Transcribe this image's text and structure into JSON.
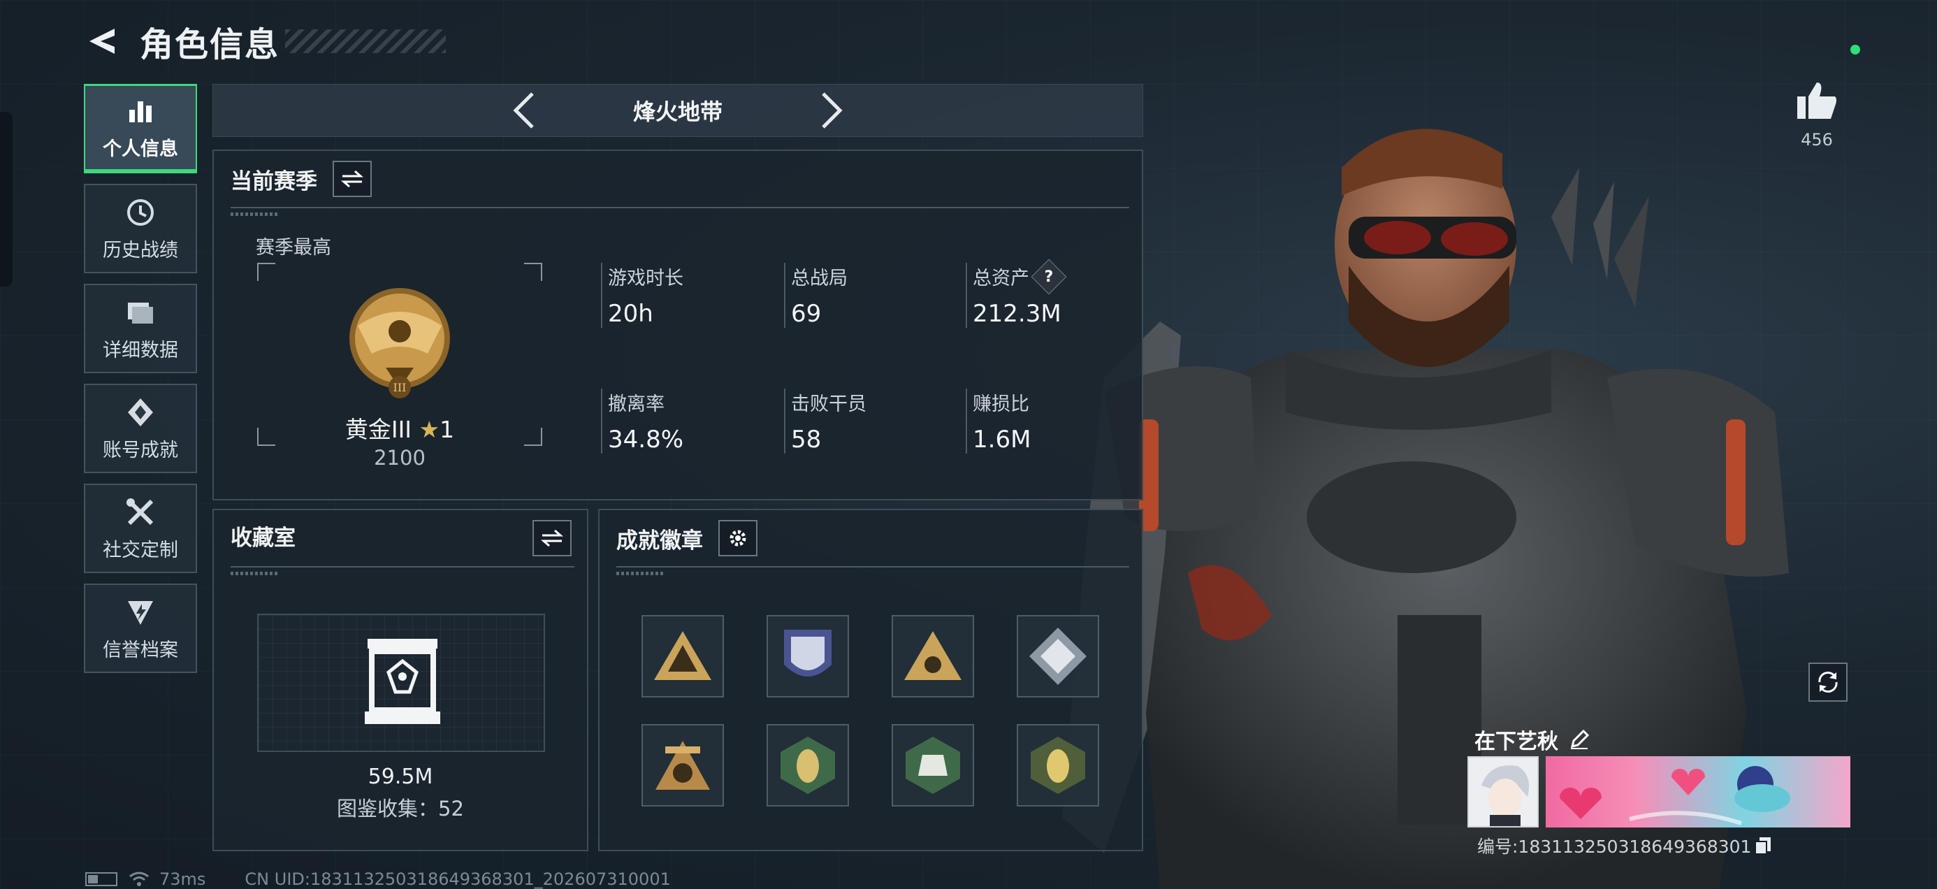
{
  "header": {
    "title": "角色信息"
  },
  "sidebar": {
    "items": [
      {
        "label": "个人信息",
        "icon": "bar-chart-icon",
        "active": true
      },
      {
        "label": "历史战绩",
        "icon": "history-clock-icon"
      },
      {
        "label": "详细数据",
        "icon": "folder-data-icon"
      },
      {
        "label": "账号成就",
        "icon": "achievement-medal-icon"
      },
      {
        "label": "社交定制",
        "icon": "wrench-tools-icon"
      },
      {
        "label": "信誉档案",
        "icon": "credit-shield-icon"
      }
    ]
  },
  "mode": {
    "title": "烽火地带"
  },
  "season": {
    "title": "当前赛季",
    "best_label": "赛季最高",
    "rank_name": "黄金III",
    "rank_star": "★",
    "rank_star_count": "1",
    "rank_score": "2100",
    "stats": [
      {
        "label": "游戏时长",
        "value": "20h"
      },
      {
        "label": "总战局",
        "value": "69"
      },
      {
        "label": "总资产",
        "value": "212.3M",
        "help": "?"
      },
      {
        "label": "撤离率",
        "value": "34.8%"
      },
      {
        "label": "击败干员",
        "value": "58"
      },
      {
        "label": "赚损比",
        "value": "1.6M"
      }
    ]
  },
  "collection": {
    "title": "收藏室",
    "value": "59.5M",
    "count_text": "图鉴收集：52"
  },
  "badges": {
    "title": "成就徽章",
    "items": [
      "gold-triangle-badge-icon",
      "blue-shield-badge-icon",
      "gold-triangle-eye-badge-icon",
      "silver-diamond-badge-icon",
      "bronze-50-badge-icon",
      "hornet-green-badge-icon",
      "green-hex-badge-icon",
      "hornet-hex-badge-icon"
    ]
  },
  "profile": {
    "likes": "456",
    "nickname": "在下艺秋",
    "uid_text": "编号:18311325031864936830​1"
  },
  "footer": {
    "ping": "73ms",
    "uid": "CN UID:18311325031864936830​1_202607310001"
  },
  "colors": {
    "accent_green": "#3fd87e",
    "gold": "#d8b35a",
    "panel_border": "#3f4c57"
  }
}
